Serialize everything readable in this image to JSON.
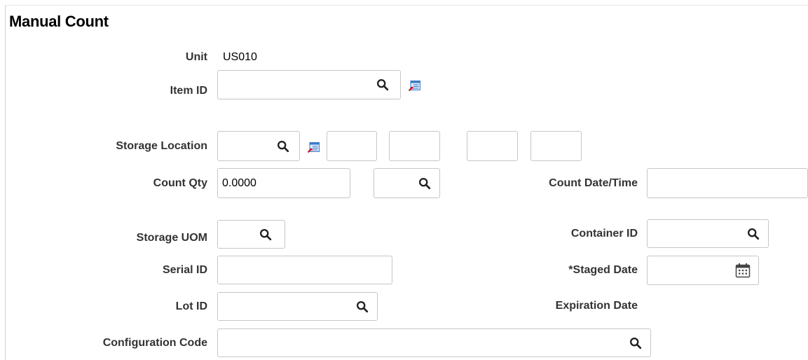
{
  "page": {
    "title": "Manual Count"
  },
  "fields": {
    "unit": {
      "label": "Unit",
      "value": "US010"
    },
    "item_id": {
      "label": "Item ID",
      "value": ""
    },
    "storage_location": {
      "label": "Storage Location",
      "value": ""
    },
    "count_qty": {
      "label": "Count Qty",
      "value": "0.0000"
    },
    "count_date_time": {
      "label": "Count Date/Time",
      "value": ""
    },
    "storage_uom": {
      "label": "Storage UOM",
      "value": ""
    },
    "container_id": {
      "label": "Container ID",
      "value": ""
    },
    "serial_id": {
      "label": "Serial ID",
      "value": ""
    },
    "staged_date": {
      "label": "*Staged Date",
      "value": ""
    },
    "lot_id": {
      "label": "Lot ID",
      "value": ""
    },
    "expiration_date": {
      "label": "Expiration Date",
      "value": ""
    },
    "configuration_code": {
      "label": "Configuration Code",
      "value": ""
    }
  },
  "icons": {
    "lookup": "search-icon",
    "related": "related-content-icon",
    "calendar": "calendar-icon"
  },
  "colors": {
    "label": "#333333",
    "border": "#c6c6c6",
    "icon_blue": "#3b7bc8",
    "icon_red": "#d0021b"
  }
}
